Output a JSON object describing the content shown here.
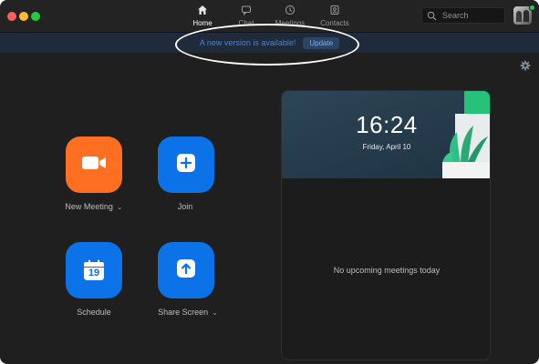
{
  "nav": {
    "tabs": [
      {
        "label": "Home",
        "icon": "home-icon",
        "active": true
      },
      {
        "label": "Chat",
        "icon": "chat-icon",
        "active": false
      },
      {
        "label": "Meetings",
        "icon": "clock-icon",
        "active": false
      },
      {
        "label": "Contacts",
        "icon": "contacts-icon",
        "active": false
      }
    ],
    "search_placeholder": "Search"
  },
  "banner": {
    "message": "A new version is available!",
    "button_label": "Update"
  },
  "actions": [
    {
      "label": "New Meeting",
      "icon": "video-camera-icon",
      "color": "#ff6f21",
      "has_dropdown": true
    },
    {
      "label": "Join",
      "icon": "plus-icon",
      "color": "#0b72e7",
      "has_dropdown": false
    },
    {
      "label": "Schedule",
      "icon": "calendar-icon",
      "icon_text": "19",
      "color": "#0b72e7",
      "has_dropdown": false
    },
    {
      "label": "Share Screen",
      "icon": "share-screen-icon",
      "color": "#0b72e7",
      "has_dropdown": true
    }
  ],
  "calendar_card": {
    "time": "16:24",
    "date": "Friday, April 10",
    "empty_message": "No upcoming meetings today"
  },
  "colors": {
    "window_bg": "#1f1f1f",
    "accent_blue": "#0b72e7",
    "accent_orange": "#ff6f21",
    "banner_bg": "#1f2b3b",
    "banner_text": "#3a86e8"
  }
}
